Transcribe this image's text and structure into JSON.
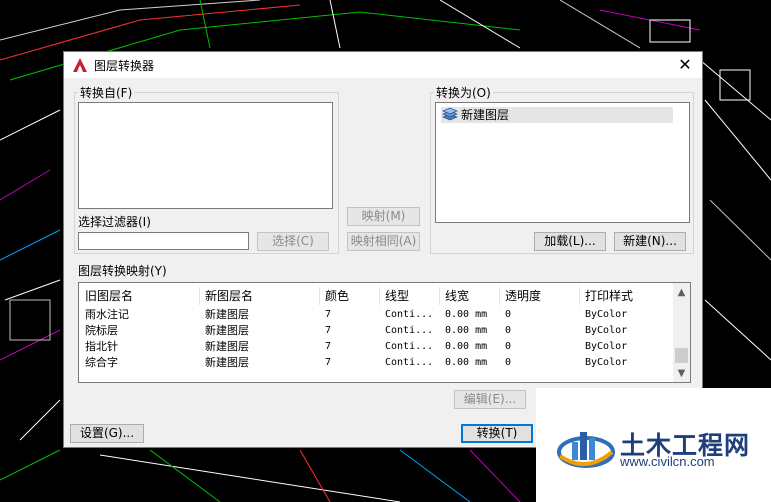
{
  "dialog": {
    "title": "图层转换器",
    "close_glyph": "✕"
  },
  "convert_from": {
    "label": "转换自(F)",
    "filter_label": "选择过滤器(I)",
    "filter_value": "",
    "select_button": "选择(C)"
  },
  "mapping_buttons": {
    "map": "映射(M)",
    "map_same": "映射相同(A)"
  },
  "convert_to": {
    "label": "转换为(O)",
    "items": [
      "新建图层"
    ],
    "load_button": "加载(L)...",
    "new_button": "新建(N)..."
  },
  "mappings": {
    "label": "图层转换映射(Y)",
    "columns": [
      "旧图层名",
      "新图层名",
      "颜色",
      "线型",
      "线宽",
      "透明度",
      "打印样式"
    ],
    "rows": [
      [
        "雨水注记",
        "新建图层",
        "7",
        "Conti...",
        "0.00 mm",
        "0",
        "ByColor"
      ],
      [
        "院标层",
        "新建图层",
        "7",
        "Conti...",
        "0.00 mm",
        "0",
        "ByColor"
      ],
      [
        "指北针",
        "新建图层",
        "7",
        "Conti...",
        "0.00 mm",
        "0",
        "ByColor"
      ],
      [
        "综合字",
        "新建图层",
        "7",
        "Conti...",
        "0.00 mm",
        "0",
        "ByColor"
      ]
    ],
    "edit_button": "编辑(E)..."
  },
  "footer": {
    "settings_button": "设置(G)...",
    "convert_button": "转换(T)"
  },
  "watermark": {
    "text_cn": "土木工程网",
    "url": "www.civilcn.com"
  },
  "colors": {
    "background": "#000000",
    "dialog": "#f0f0f0",
    "accent": "#0078d7",
    "autocad_red": "#c8202a"
  }
}
